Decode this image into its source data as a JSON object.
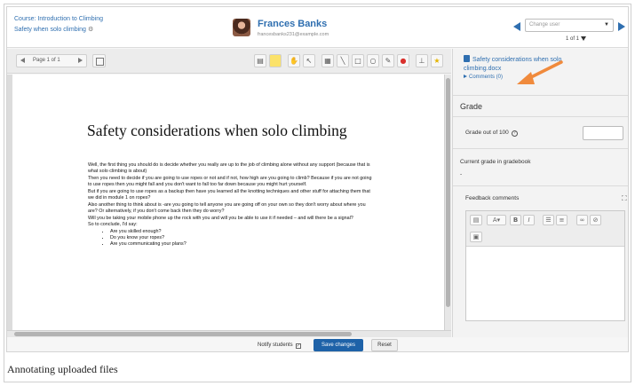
{
  "header": {
    "course_link": "Course: Introduction to Climbing",
    "assignment_link": "Safety when solo climbing",
    "user_name": "Frances Banks",
    "user_email": "francesbanks231@example.com",
    "change_user_placeholder": "Change user",
    "user_count": "1 of 1"
  },
  "toolbar": {
    "page_indicator": "Page 1 of 1"
  },
  "document": {
    "title": "Safety considerations when solo climbing",
    "paragraphs": [
      "Well, the first thing you should do is decide whether you really are up to the job of climbing alone without any support (because that is what solo climbing is about)",
      "Then you need to decide if you are going to use ropes or not and if not, how high are you going to climb? Because if you are not going to use ropes then you might fall and you don't want to fall too far down because you might hurt yourself.",
      "But if you are going to use ropes as a backup then have you learned all the knotting techniques and other stuff for attaching them that we did in module 1 on ropes?",
      "Also another thing to think about is -are you going to tell anyone you are going off on your own so they don't worry about where you are? Or alternatively, if you don't come back then they do worry?",
      "Will you be taking your mobile phone up the rock with you and will you be able to use it if needed – and will there be a signal?",
      "So to conclude, I'd say:"
    ],
    "bullets": [
      "Are you skilled enough?",
      "Do you know your ropes?",
      "Are you communicating your plans?"
    ]
  },
  "panel": {
    "file_link": "Safety considerations when solo climbing.docx",
    "comments_link": "Comments (0)",
    "grade_heading": "Grade",
    "grade_label": "Grade out of 100",
    "current_grade_label": "Current grade in gradebook",
    "current_grade_value": "-",
    "feedback_label": "Feedback comments",
    "editor_buttons": [
      "A",
      "B",
      "I"
    ]
  },
  "footer": {
    "notify_label": "Notify students",
    "save_label": "Save changes",
    "reset_label": "Reset"
  },
  "caption": "Annotating uploaded files",
  "colors": {
    "link": "#2f6fb0",
    "primary_button": "#1e62a8",
    "annotation_arrow": "#f08a3c"
  }
}
